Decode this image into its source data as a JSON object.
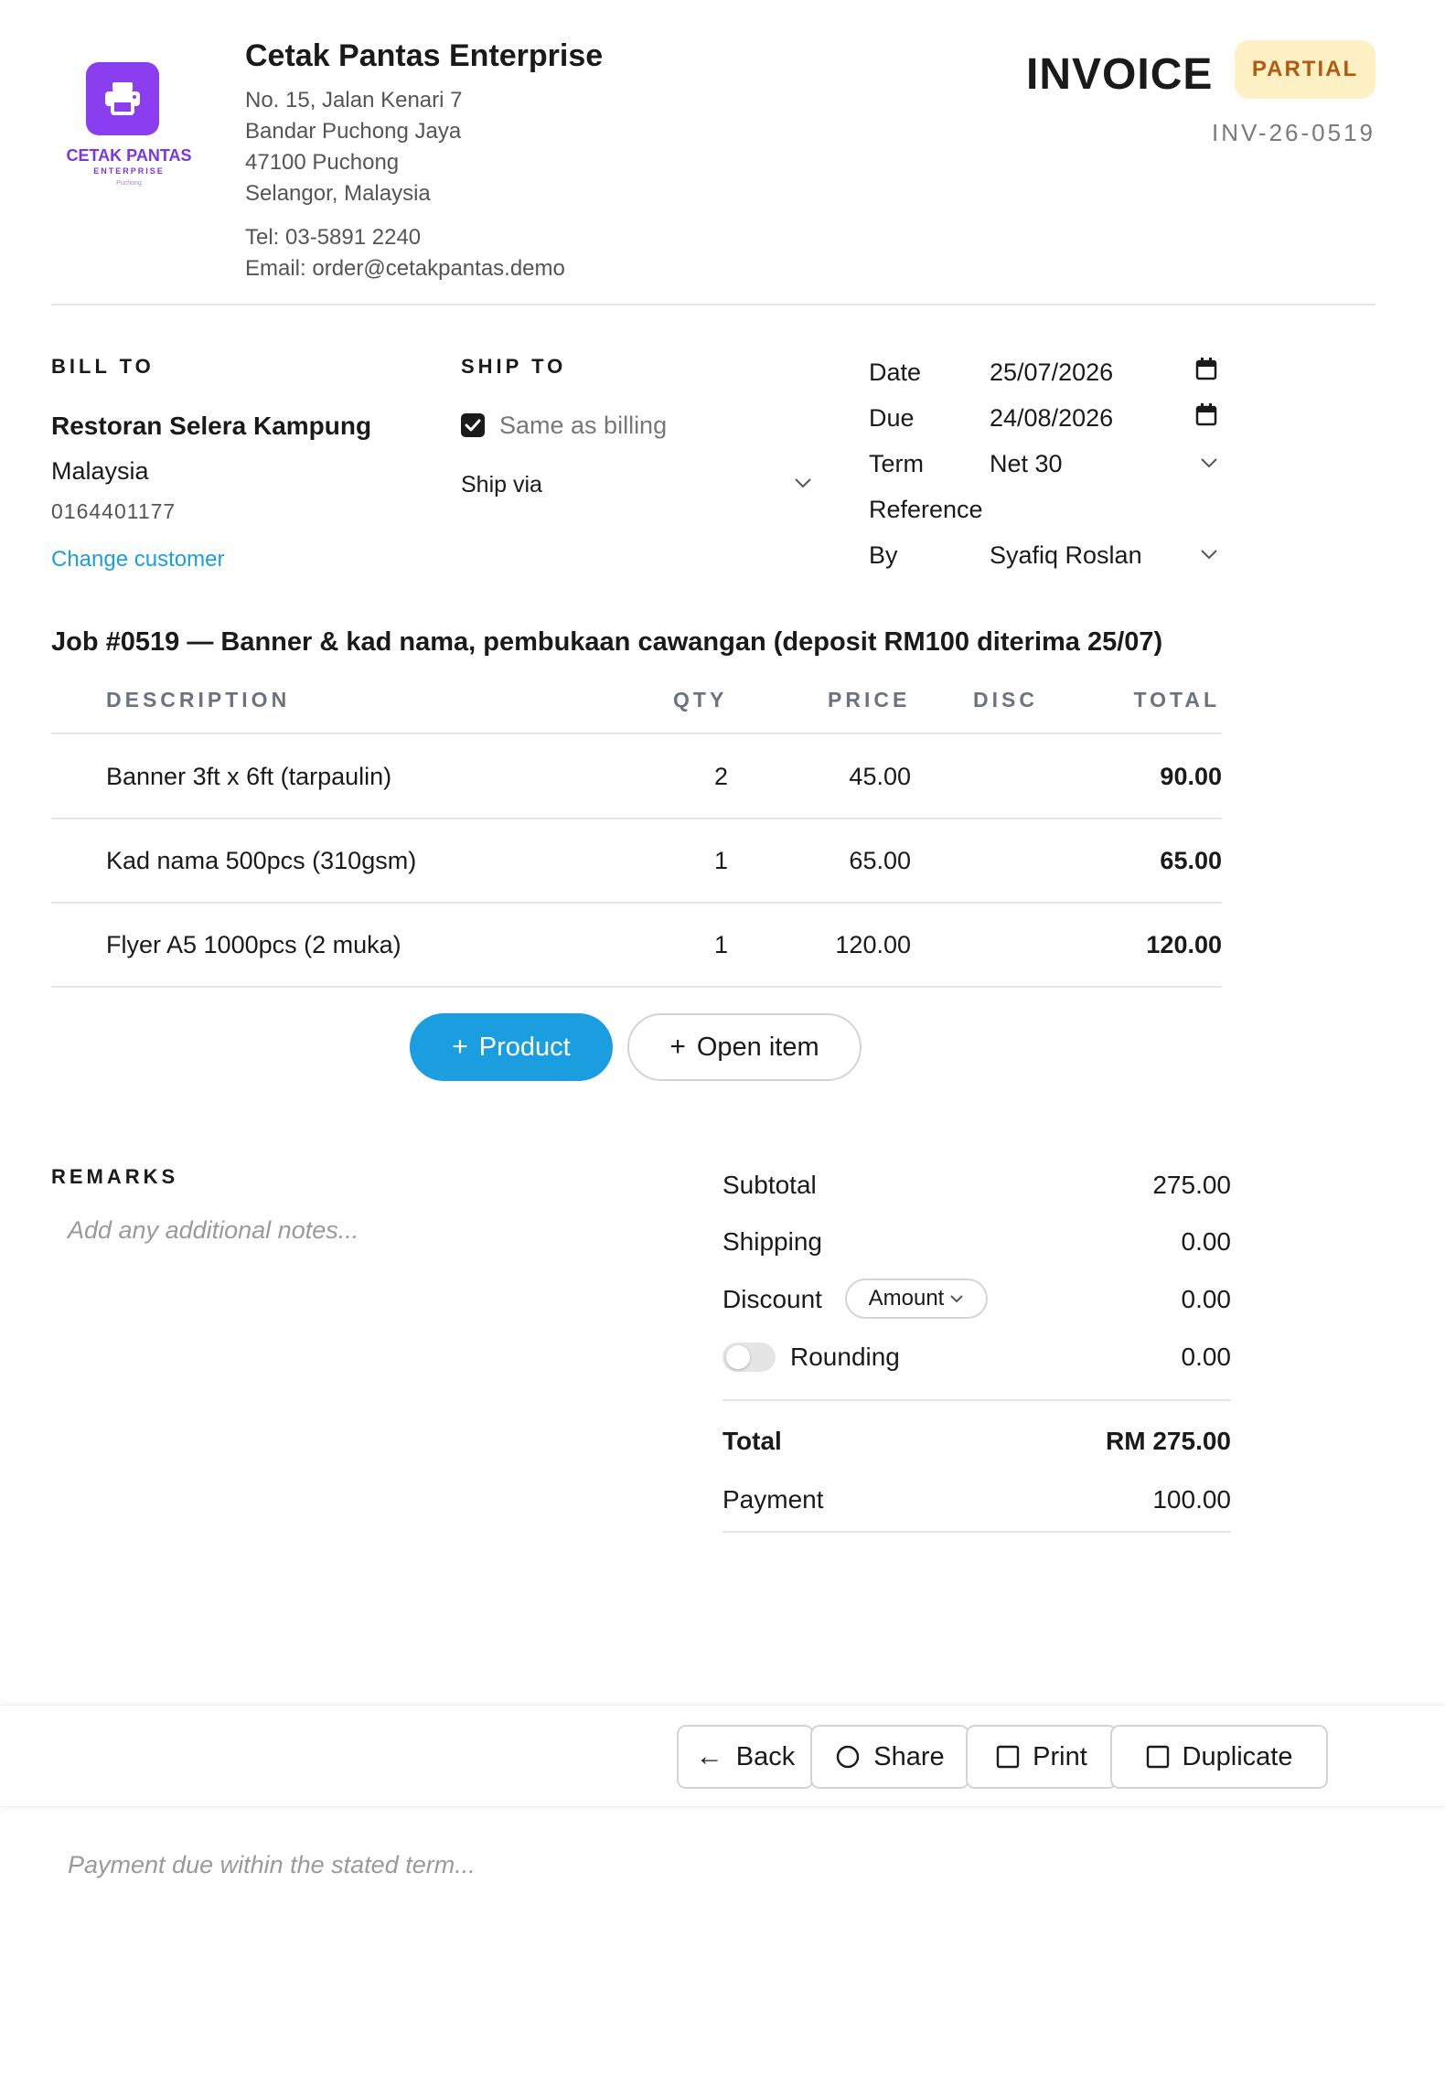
{
  "company": {
    "logo_name": "CETAK PANTAS",
    "logo_sub": "ENTERPRISE",
    "logo_loc": "Puchong",
    "name": "Cetak Pantas Enterprise",
    "address": [
      "No. 15, Jalan Kenari 7",
      "Bandar Puchong Jaya",
      "47100 Puchong",
      "Selangor, Malaysia"
    ],
    "tel": "Tel: 03-5891 2240",
    "email": "Email: order@cetakpantas.demo",
    "brand_color": "#8b3df0"
  },
  "invoice": {
    "title": "INVOICE",
    "status": "PARTIAL",
    "number": "INV-26-0519"
  },
  "bill_to": {
    "label": "BILL TO",
    "name": "Restoran Selera Kampung",
    "country": "Malaysia",
    "phone": "0164401177",
    "change_link": "Change customer"
  },
  "ship_to": {
    "label": "SHIP TO",
    "same_as_billing_label": "Same as billing",
    "same_as_billing_checked": true,
    "ship_via_label": "Ship via"
  },
  "meta": {
    "date_label": "Date",
    "date_value": "25/07/2026",
    "due_label": "Due",
    "due_value": "24/08/2026",
    "term_label": "Term",
    "term_value": "Net 30",
    "reference_label": "Reference",
    "reference_value": "",
    "by_label": "By",
    "by_value": "Syafiq Roslan"
  },
  "job_title": "Job #0519 — Banner & kad nama, pembukaan cawangan (deposit RM100 diterima 25/07)",
  "table": {
    "headers": {
      "description": "DESCRIPTION",
      "qty": "QTY",
      "price": "PRICE",
      "disc": "DISC",
      "total": "TOTAL"
    },
    "rows": [
      {
        "description": "Banner 3ft x 6ft (tarpaulin)",
        "qty": "2",
        "price": "45.00",
        "disc": "",
        "total": "90.00"
      },
      {
        "description": "Kad nama 500pcs (310gsm)",
        "qty": "1",
        "price": "65.00",
        "disc": "",
        "total": "65.00"
      },
      {
        "description": "Flyer A5 1000pcs (2 muka)",
        "qty": "1",
        "price": "120.00",
        "disc": "",
        "total": "120.00"
      }
    ]
  },
  "actions": {
    "add_product": "Product",
    "add_open_item": "Open item"
  },
  "remarks": {
    "label": "REMARKS",
    "placeholder": "Add any additional notes..."
  },
  "summary": {
    "subtotal_label": "Subtotal",
    "subtotal_value": "275.00",
    "shipping_label": "Shipping",
    "shipping_value": "0.00",
    "discount_label": "Discount",
    "discount_mode": "Amount",
    "discount_value": "0.00",
    "rounding_label": "Rounding",
    "rounding_on": false,
    "rounding_value": "0.00",
    "total_label": "Total",
    "total_value": "RM 275.00",
    "payment_label": "Payment",
    "payment_value": "100.00"
  },
  "footer_buttons": {
    "back": "Back",
    "share": "Share",
    "print": "Print",
    "duplicate": "Duplicate"
  },
  "footer_note": "Payment due within the stated term...",
  "colors": {
    "accent": "#1a9ee0",
    "badge_bg": "#fdf0c4",
    "badge_text": "#b25b10"
  }
}
